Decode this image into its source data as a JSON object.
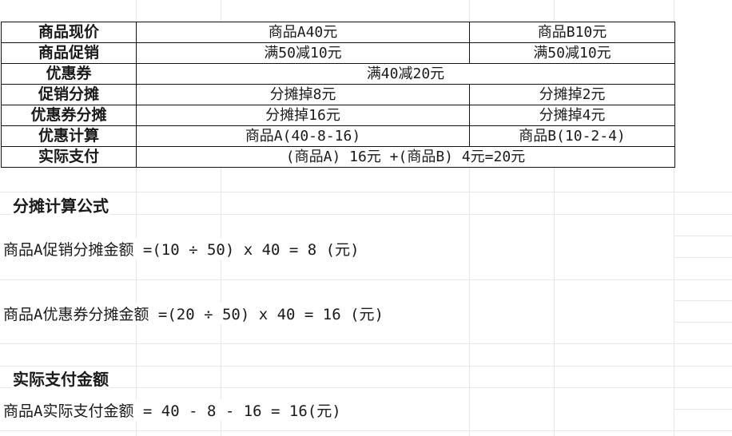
{
  "table": {
    "rows": [
      {
        "label": "商品现价",
        "a": "商品A40元",
        "b": "商品B10元"
      },
      {
        "label": "商品促销",
        "a": "满50减10元",
        "b": "满50减10元"
      },
      {
        "label": "优惠券",
        "merged": "满40减20元"
      },
      {
        "label": "促销分摊",
        "a": "分摊掉8元",
        "b": "分摊掉2元"
      },
      {
        "label": "优惠券分摊",
        "a": "分摊掉16元",
        "b": "分摊掉4元"
      },
      {
        "label": "优惠计算",
        "a": "商品A(40-8-16)",
        "b": "商品B(10-2-4)"
      },
      {
        "label": "实际支付",
        "merged": "(商品A) 16元 +(商品B) 4元=20元"
      }
    ]
  },
  "section1": {
    "title": "分摊计算公式",
    "formula1": "商品A促销分摊金额 =(10 ÷ 50) x 40 = 8 (元)",
    "formula2": "商品A优惠券分摊金额 =(20 ÷ 50) x 40 = 16 (元)"
  },
  "section2": {
    "title": "实际支付金额",
    "formula": "商品A实际支付金额 = 40 - 8 - 16 = 16(元)"
  }
}
